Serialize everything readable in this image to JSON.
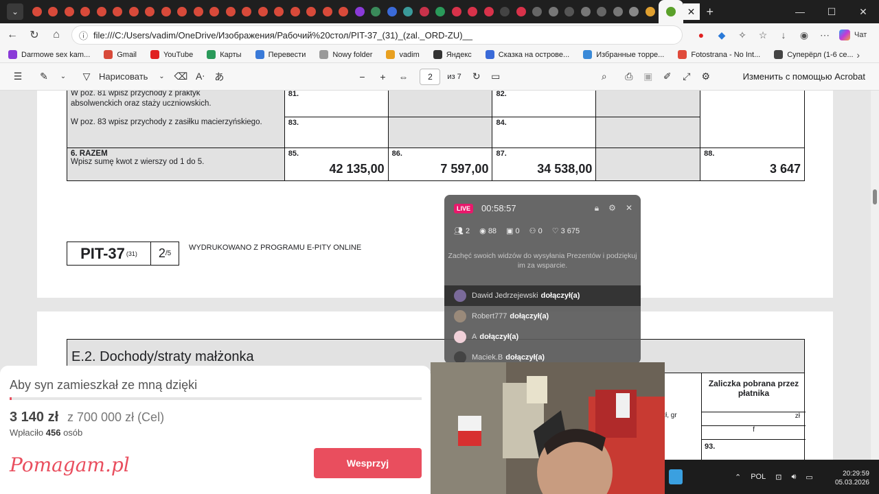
{
  "browser": {
    "url": "file:///C:/Users/vadim/OneDrive/Изображения/Рабочий%20стол/PIT-37_(31)_(zal._ORD-ZU)__",
    "tab_colors": [
      "#d84a3a",
      "#d84a3a",
      "#d84a3a",
      "#d84a3a",
      "#d84a3a",
      "#d84a3a",
      "#d84a3a",
      "#d84a3a",
      "#d84a3a",
      "#d84a3a",
      "#d84a3a",
      "#d84a3a",
      "#d84a3a",
      "#d84a3a",
      "#d84a3a",
      "#d84a3a",
      "#d84a3a",
      "#d84a3a",
      "#d84a3a",
      "#d84a3a",
      "#8a3ad8",
      "#3a8a5a",
      "#3a6ad8",
      "#3a9a9a",
      "#c8324a",
      "#2a9a5a",
      "#d8324a",
      "#d8324a",
      "#d8324a",
      "#444444",
      "#d8324a",
      "#666666",
      "#777777",
      "#555555",
      "#777777",
      "#666666",
      "#777777",
      "#888888",
      "#e0a030",
      "#5aa02a"
    ],
    "window_controls": [
      "—",
      "☐",
      "✕"
    ],
    "copilot_label": "Чат"
  },
  "bookmarks": [
    {
      "label": "Darmowe sex kam...",
      "color": "#8a3ad8"
    },
    {
      "label": "Gmail",
      "color": "#d84a3a"
    },
    {
      "label": "YouTube",
      "color": "#e02020"
    },
    {
      "label": "Карты",
      "color": "#2a9a5a"
    },
    {
      "label": "Перевести",
      "color": "#3a7ad8"
    },
    {
      "label": "Nowy folder",
      "color": "#999999"
    },
    {
      "label": "vadim",
      "color": "#e8a020"
    },
    {
      "label": "Яндекс",
      "color": "#333333"
    },
    {
      "label": "Сказка на острове...",
      "color": "#3a6ad8"
    },
    {
      "label": "Избранные торре...",
      "color": "#3a8ad8"
    },
    {
      "label": "Fotostrana - No Int...",
      "color": "#e04a3a"
    },
    {
      "label": "Суперёрл (1-6 се...",
      "color": "#444444"
    }
  ],
  "pdf_toolbar": {
    "draw_label": "Нарисовать",
    "page_current": "2",
    "page_of": "из 7",
    "acrobat_label": "Изменить с помощью Acrobat"
  },
  "page1": {
    "text_81": "W poz. 81 wpisz przychody z praktyk absolwenckich oraz staży uczniowskich.",
    "text_83": "W poz. 83 wpisz przychody z zasiłku macierzyńskiego.",
    "n81": "81.",
    "n82": "82.",
    "n83": "83.",
    "n84": "84.",
    "razem_title": "6. RAZEM",
    "razem_desc": "Wpisz sumę kwot z wierszy od 1 do 5.",
    "n85": "85.",
    "v85": "42 135,00",
    "n86": "86.",
    "v86": "7 597,00",
    "n87": "87.",
    "v87": "34 538,00",
    "n88": "88.",
    "v88": "3 647",
    "pit_label": "PIT-37",
    "pit_sub": "(31)",
    "page_num": "2",
    "page_total": "/5",
    "printed": "WYDRUKOWANO Z PROGRAMU E-PITY ONLINE"
  },
  "page2": {
    "section_title": "E.2. Dochody/straty małżonka",
    "zaliczka": "Zaliczka pobrana przez płatnika",
    "zl_gr": "zł, gr",
    "zl": "zł",
    "f": "f",
    "n93": "93."
  },
  "live": {
    "badge": "LIVE",
    "time": "00:58:57",
    "stats": {
      "friends": "2",
      "views": "88",
      "gifts": "0",
      "follows": "0",
      "likes": "3 675"
    },
    "hint": "Zachęć swoich widzów do wysyłania Prezentów i podziękuj im za wsparcie.",
    "feed": [
      {
        "user": "Dawid Jedrzejewski",
        "action": "dołączył(a)",
        "color": "#7a6a9a"
      },
      {
        "user": "Robert777",
        "action": "dołączył(a)",
        "color": "#9a8a7a"
      },
      {
        "user": "A",
        "action": "dołączył(a)",
        "color": "#f0d0d8"
      },
      {
        "user": "Maciek.B",
        "action": "dołączył(a)",
        "color": "#444444"
      }
    ]
  },
  "donation": {
    "title": "Aby syn zamieszkał ze mną dzięki",
    "progress": 0.0045,
    "amount": "3 140 zł",
    "goal": "z 700 000 zł (Cel)",
    "paid_prefix": "Wpłaciło",
    "paid_count": "456",
    "paid_suffix": "osób",
    "logo": "Pomagam.pl",
    "button": "Wesprzyj"
  },
  "taskbar": {
    "lang": "POL",
    "time": "20:29:59",
    "date": "05.03.2026"
  }
}
